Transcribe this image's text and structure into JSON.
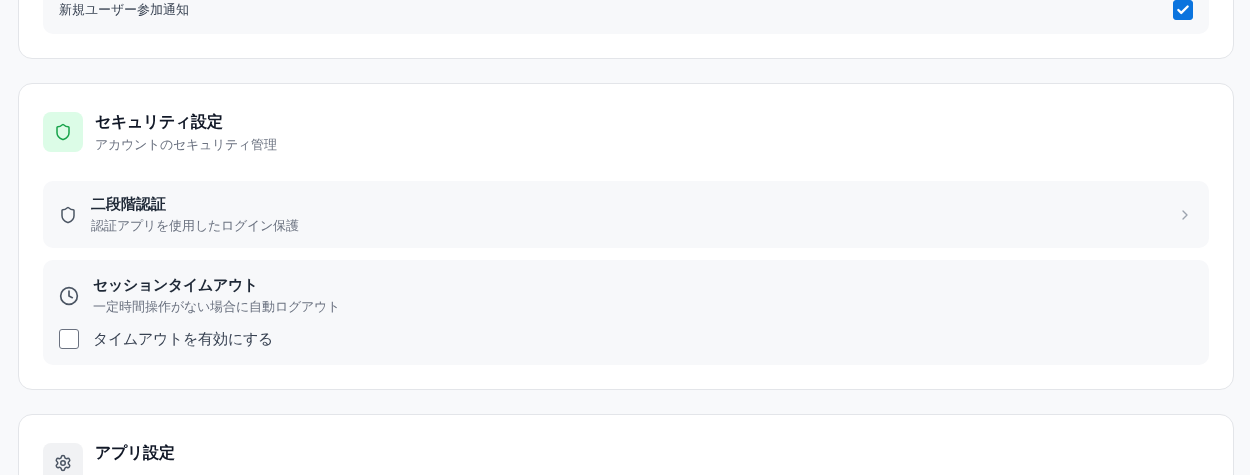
{
  "sections": [
    {
      "kind": "list",
      "items": [
        {
          "kind": "checkbox",
          "label": "新規ユーザー参加通知",
          "checked": true
        }
      ]
    },
    {
      "kind": "security",
      "title": "セキュリティ設定",
      "subtitle": "アカウントのセキュリティ管理",
      "items": [
        {
          "kind": "link",
          "title": "二段階認証",
          "description": "認証アプリを使用したログイン保護"
        },
        {
          "kind": "option",
          "title": "セッションタイムアウト",
          "description": "一定時間操作がない場合に自動ログアウト",
          "checkbox": {
            "label": "タイムアウトを有効にする",
            "checked": false
          }
        }
      ]
    },
    {
      "kind": "app",
      "title": "アプリ設定"
    }
  ]
}
